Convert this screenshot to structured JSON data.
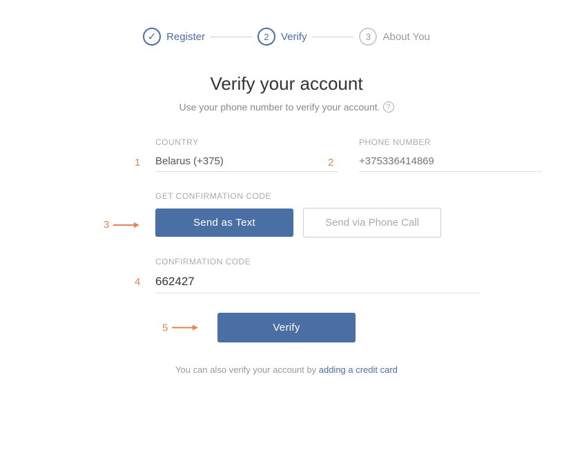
{
  "stepper": {
    "steps": [
      {
        "id": "register",
        "label": "Register",
        "number": null,
        "status": "completed"
      },
      {
        "id": "verify",
        "label": "Verify",
        "number": "2",
        "status": "active"
      },
      {
        "id": "about",
        "label": "About You",
        "number": "3",
        "status": "inactive"
      }
    ]
  },
  "page": {
    "title": "Verify your account",
    "subtitle": "Use your phone number to verify your account.",
    "help_tooltip": "?"
  },
  "form": {
    "country_label": "Country",
    "country_value": "Belarus (+375)",
    "phone_label": "Phone Number",
    "phone_placeholder": "+375336414869",
    "code_section_label": "Get Confirmation Code",
    "send_text_label": "Send as Text",
    "send_call_label": "Send via Phone Call",
    "confirmation_label": "Confirmation Code",
    "confirmation_value": "662427",
    "verify_label": "Verify"
  },
  "footer": {
    "text_before": "You can also verify your account by",
    "link_text": "adding a credit card"
  },
  "step_numbers": {
    "n1": "1",
    "n2": "2",
    "n3": "3",
    "n4": "4",
    "n5": "5"
  },
  "icons": {
    "check": "✓",
    "help": "?",
    "arrow": "→"
  }
}
